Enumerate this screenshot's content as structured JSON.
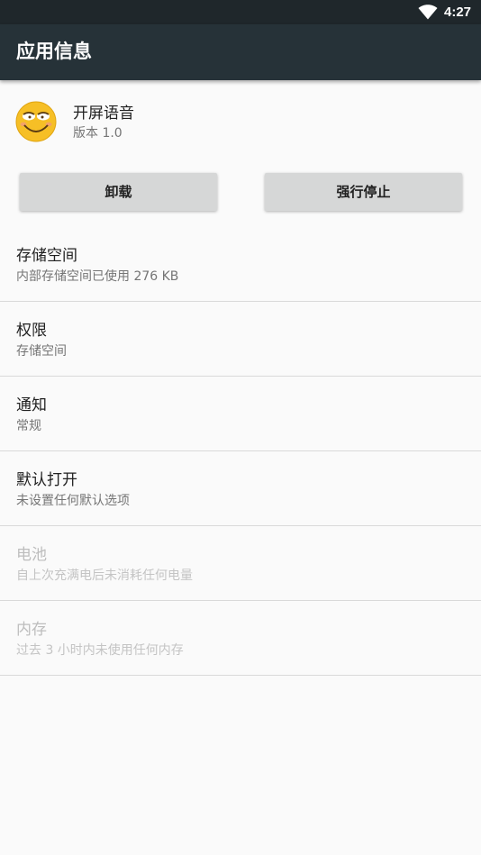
{
  "status_bar": {
    "time": "4:27",
    "wifi_icon": "wifi-icon"
  },
  "app_bar": {
    "title": "应用信息"
  },
  "app": {
    "name": "开屏语音",
    "version": "版本 1.0",
    "icon": "smiley-face-icon"
  },
  "buttons": {
    "uninstall": "卸载",
    "force_stop": "强行停止"
  },
  "settings": [
    {
      "title": "存储空间",
      "subtitle": "内部存储空间已使用 276 KB",
      "enabled": true
    },
    {
      "title": "权限",
      "subtitle": "存储空间",
      "enabled": true
    },
    {
      "title": "通知",
      "subtitle": "常规",
      "enabled": true
    },
    {
      "title": "默认打开",
      "subtitle": "未设置任何默认选项",
      "enabled": true
    },
    {
      "title": "电池",
      "subtitle": "自上次充满电后未消耗任何电量",
      "enabled": false
    },
    {
      "title": "内存",
      "subtitle": "过去 3 小时内未使用任何内存",
      "enabled": false
    }
  ],
  "colors": {
    "app_bar": "#263238",
    "status_bar": "#1f272b",
    "background": "#fafafa",
    "button": "#d6d7d7"
  }
}
